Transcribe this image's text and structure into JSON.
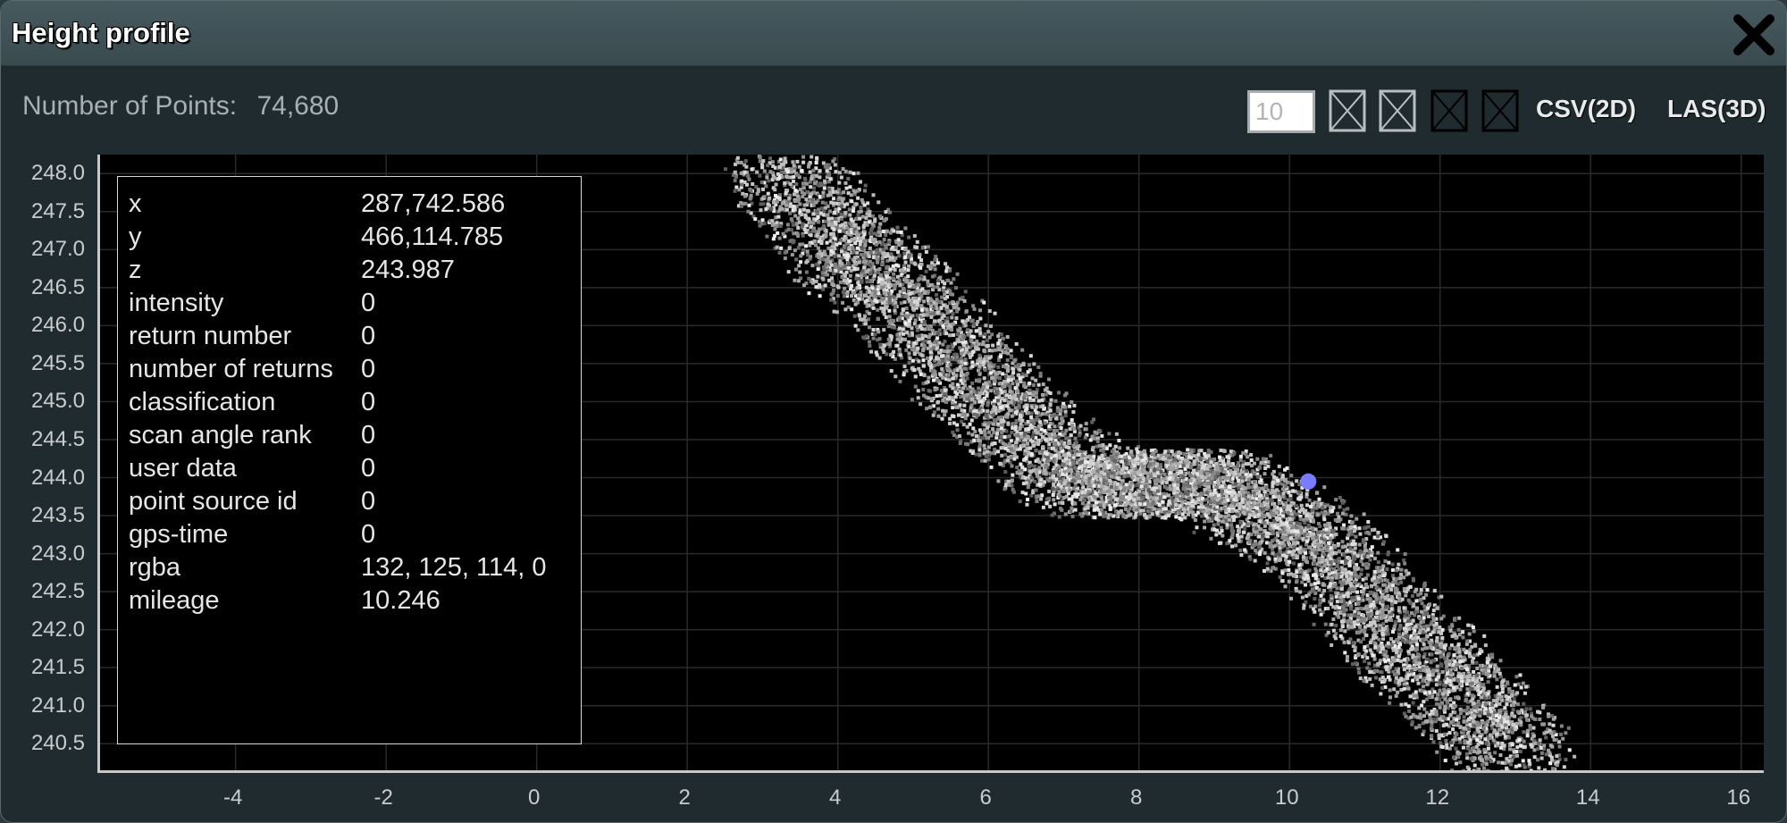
{
  "window": {
    "title": "Height profile",
    "close_icon": "close-x-icon"
  },
  "info": {
    "num_points_label": "Number of Points:",
    "num_points_value": "74,680",
    "point_budget_value": "10",
    "toggle_icons": [
      "checkbox-x-icon",
      "checkbox-x-icon",
      "checkbox-x-icon",
      "checkbox-x-icon"
    ],
    "csv_label": "CSV(2D)",
    "las_label": "LAS(3D)"
  },
  "chart_data": {
    "type": "scatter",
    "title": "",
    "xlabel": "",
    "ylabel": "",
    "x_ticks": [
      "-4",
      "-2",
      "0",
      "2",
      "4",
      "6",
      "8",
      "10",
      "12",
      "14",
      "16"
    ],
    "y_ticks": [
      "248.0",
      "247.5",
      "247.0",
      "246.5",
      "246.0",
      "245.5",
      "245.0",
      "244.5",
      "244.0",
      "243.5",
      "243.0",
      "242.5",
      "242.0",
      "241.5",
      "241.0",
      "240.5"
    ],
    "xlim": [
      -5.8,
      16.3
    ],
    "ylim": [
      240.15,
      248.25
    ],
    "grid": true,
    "series": [
      {
        "points_profile": [
          [
            3.1,
            248.3
          ],
          [
            3.6,
            247.6
          ],
          [
            4.1,
            247.0
          ],
          [
            4.6,
            246.6
          ],
          [
            5.1,
            246.1
          ],
          [
            5.6,
            245.5
          ],
          [
            6.1,
            245.0
          ],
          [
            6.6,
            244.5
          ],
          [
            7.1,
            244.1
          ],
          [
            7.6,
            243.9
          ],
          [
            8.1,
            243.9
          ],
          [
            8.6,
            244.0
          ],
          [
            9.1,
            243.9
          ],
          [
            9.6,
            243.6
          ],
          [
            10.1,
            243.3
          ],
          [
            10.6,
            242.9
          ],
          [
            11.1,
            242.3
          ],
          [
            11.6,
            241.8
          ],
          [
            12.1,
            241.3
          ],
          [
            12.6,
            240.8
          ],
          [
            13.1,
            240.3
          ]
        ],
        "color": "#bdbdbd"
      }
    ],
    "selected_point": {
      "x": 10.25,
      "y": 243.95,
      "color": "#7b7bff"
    }
  },
  "selected_attributes": [
    {
      "key": "x",
      "value": "287,742.586"
    },
    {
      "key": "y",
      "value": "466,114.785"
    },
    {
      "key": "z",
      "value": "243.987"
    },
    {
      "key": "intensity",
      "value": "0"
    },
    {
      "key": "return number",
      "value": "0"
    },
    {
      "key": "number of returns",
      "value": "0"
    },
    {
      "key": "classification",
      "value": "0"
    },
    {
      "key": "scan angle rank",
      "value": "0"
    },
    {
      "key": "user data",
      "value": "0"
    },
    {
      "key": "point source id",
      "value": "0"
    },
    {
      "key": "gps-time",
      "value": "0"
    },
    {
      "key": "rgba",
      "value": "132, 125, 114, 0"
    },
    {
      "key": "mileage",
      "value": "10.246"
    }
  ]
}
